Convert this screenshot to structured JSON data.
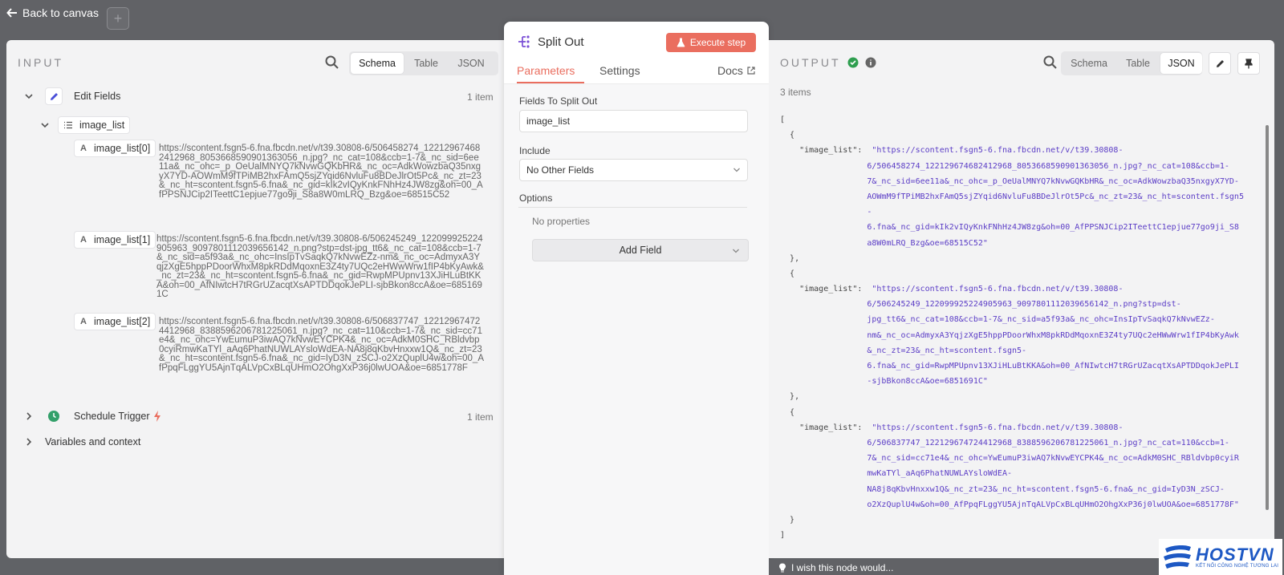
{
  "header": {
    "back_label": "Back to canvas",
    "plus_label": "+"
  },
  "input": {
    "label": "INPUT",
    "view_tabs": [
      "Schema",
      "Table",
      "JSON"
    ],
    "active_view": "Schema",
    "tree": {
      "node_name": "Edit Fields",
      "node_count": "1 item",
      "field_name": "image_list",
      "items": [
        {
          "name": "image_list[0]",
          "type": "A",
          "value": "https://scontent.fsgn5-6.fna.fbcdn.net/v/t39.30808-6/506458274_122129674682412968_8053668590901363056_n.jpg?_nc_cat=108&ccb=1-7&_nc_sid=6ee11a&_nc_ohc=_p_OeUalMNYQ7kNvwGQKbHR&_nc_oc=AdkWowzbaQ35nxgyX7YD-AOWmM9fTPiMB2hxFAmQ5sjZYqid6NvluFu8BDeJlrOt5Pc&_nc_zt=23&_nc_ht=scontent.fsgn5-6.fna&_nc_gid=kIk2vIQyKnkFNhHz4JW8zg&oh=00_AfPPSNJCip2ITeettC1epjue77go9ji_S8a8W0mLRQ_Bzg&oe=68515C52"
        },
        {
          "name": "image_list[1]",
          "type": "A",
          "value": "https://scontent.fsgn5-6.fna.fbcdn.net/v/t39.30808-6/506245249_122099925224905963_9097801112039656142_n.png?stp=dst-jpg_tt6&_nc_cat=108&ccb=1-7&_nc_sid=a5f93a&_nc_ohc=InsIpTvSaqkQ7kNvwEZz-nm&_nc_oc=AdmyxA3YqjzXgE5hppPDoorWhxM8pkRDdMqoxnE3Z4ty7UQc2eHWwWrw1fIP4bKyAwk&_nc_zt=23&_nc_ht=scontent.fsgn5-6.fna&_nc_gid=RwpMPUpnv13XJiHLuBtKKA&oh=00_AfNIwtcH7tRGrUZacqtXsAPTDDqokJePLI-sjbBkon8ccA&oe=6851691C"
        },
        {
          "name": "image_list[2]",
          "type": "A",
          "value": "https://scontent.fsgn5-6.fna.fbcdn.net/v/t39.30808-6/506837747_122129674724412968_8388596206781225061_n.jpg?_nc_cat=110&ccb=1-7&_nc_sid=cc71e4&_nc_ohc=YwEumuP3iwAQ7kNvwEYCPK4&_nc_oc=AdkM0SHC_RBldvbp0cyiRmwKaTYl_aAq6PhatNUWLAYsloWdEA-NA8j8qKbvHnxxw1Q&_nc_zt=23&_nc_ht=scontent.fsgn5-6.fna&_nc_gid=IyD3N_zSCJ-o2XzQuplU4w&oh=00_AfPpqFLggYU5AjnTqALVpCxBLqUHmO2OhgXxP36j0lwUOA&oe=6851778F"
        }
      ],
      "trigger_name": "Schedule Trigger",
      "trigger_count": "1 item",
      "vars_label": "Variables and context"
    }
  },
  "node": {
    "title": "Split Out",
    "execute_label": "Execute step",
    "tabs": [
      "Parameters",
      "Settings"
    ],
    "docs_label": "Docs",
    "fields_to_split_label": "Fields To Split Out",
    "fields_to_split_value": "image_list",
    "include_label": "Include",
    "include_value": "No Other Fields",
    "options_label": "Options",
    "no_properties": "No properties",
    "add_field_label": "Add Field"
  },
  "output": {
    "label": "OUTPUT",
    "view_tabs": [
      "Schema",
      "Table",
      "JSON"
    ],
    "active_view": "JSON",
    "items_count": "3 items",
    "json_lines": [
      [
        "",
        "[",
        ""
      ],
      [
        "  ",
        "{",
        ""
      ],
      [
        "    ",
        "\"image_list\":",
        "\"https://scontent.fsgn5-6.fna.fbcdn.net/v/t39.30808-"
      ],
      [
        "                  ",
        "",
        "6/506458274_122129674682412968_8053668590901363056_n.jpg?_nc_cat=108&ccb=1-"
      ],
      [
        "                  ",
        "",
        "7&_nc_sid=6ee11a&_nc_ohc=_p_OeUalMNYQ7kNvwGQKbHR&_nc_oc=AdkWowzbaQ35nxgyX7YD-"
      ],
      [
        "                  ",
        "",
        "AOWmM9fTPiMB2hxFAmQ5sjZYqid6NvluFu8BDeJlrOt5Pc&_nc_zt=23&_nc_ht=scontent.fsgn5"
      ],
      [
        "                  ",
        "",
        "-"
      ],
      [
        "                  ",
        "",
        "6.fna&_nc_gid=kIk2vIQyKnkFNhHz4JW8zg&oh=00_AfPPSNJCip2ITeettC1epjue77go9ji_S8"
      ],
      [
        "                  ",
        "",
        "a8W0mLRQ_Bzg&oe=68515C52\""
      ],
      [
        "  ",
        "},",
        ""
      ],
      [
        "  ",
        "{",
        ""
      ],
      [
        "    ",
        "\"image_list\":",
        "\"https://scontent.fsgn5-6.fna.fbcdn.net/v/t39.30808-"
      ],
      [
        "                  ",
        "",
        "6/506245249_122099925224905963_9097801112039656142_n.png?stp=dst-"
      ],
      [
        "                  ",
        "",
        "jpg_tt6&_nc_cat=108&ccb=1-7&_nc_sid=a5f93a&_nc_ohc=InsIpTvSaqkQ7kNvwEZz-"
      ],
      [
        "                  ",
        "",
        "nm&_nc_oc=AdmyxA3YqjzXgE5hppPDoorWhxM8pkRDdMqoxnE3Z4ty7UQc2eHWwWrw1fIP4bKyAwk"
      ],
      [
        "                  ",
        "",
        "&_nc_zt=23&_nc_ht=scontent.fsgn5-"
      ],
      [
        "                  ",
        "",
        "6.fna&_nc_gid=RwpMPUpnv13XJiHLuBtKKA&oh=00_AfNIwtcH7tRGrUZacqtXsAPTDDqokJePLI"
      ],
      [
        "                  ",
        "",
        "-sjbBkon8ccA&oe=6851691C\""
      ],
      [
        "  ",
        "},",
        ""
      ],
      [
        "  ",
        "{",
        ""
      ],
      [
        "    ",
        "\"image_list\":",
        "\"https://scontent.fsgn5-6.fna.fbcdn.net/v/t39.30808-"
      ],
      [
        "                  ",
        "",
        "6/506837747_122129674724412968_8388596206781225061_n.jpg?_nc_cat=110&ccb=1-"
      ],
      [
        "                  ",
        "",
        "7&_nc_sid=cc71e4&_nc_ohc=YwEumuP3iwAQ7kNvwEYCPK4&_nc_oc=AdkM0SHC_RBldvbp0cyiR"
      ],
      [
        "                  ",
        "",
        "mwKaTYl_aAq6PhatNUWLAYsloWdEA-"
      ],
      [
        "                  ",
        "",
        "NA8j8qKbvHnxxw1Q&_nc_zt=23&_nc_ht=scontent.fsgn5-6.fna&_nc_gid=IyD3N_zSCJ-"
      ],
      [
        "                  ",
        "",
        "o2XzQuplU4w&oh=00_AfPpqFLggYU5AjnTqALVpCxBLqUHmO2OhgXxP36j0lwUOA&oe=6851778F\""
      ],
      [
        "  ",
        "}",
        ""
      ],
      [
        "",
        "]",
        ""
      ]
    ]
  },
  "footer": {
    "hint": "I wish this node would..."
  },
  "watermark": {
    "name": "HOSTVN",
    "tagline": "KẾT NỐI CÔNG NGHỆ TƯƠNG LAI"
  },
  "colors": {
    "accent": "#ea6e5f",
    "json_string": "#5b3dc6",
    "success": "#2e9e4f",
    "brand": "#1d58c4"
  }
}
